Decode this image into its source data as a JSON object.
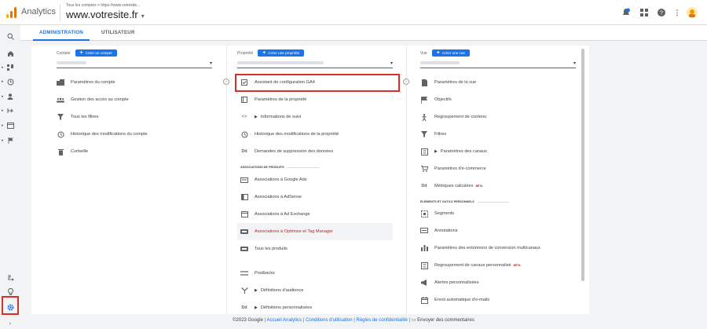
{
  "topbar": {
    "app_name": "Analytics",
    "breadcrumb": "Tous les comptes > https://www.votresite...",
    "account_name": "www.votresite.fr",
    "colors": {
      "logo": [
        "#f9ab00",
        "#e37400",
        "#e37400"
      ]
    },
    "icons": [
      "notifications-icon",
      "apps-grid-icon",
      "help-icon",
      "more-vert-icon",
      "avatar"
    ]
  },
  "tabs": [
    {
      "label": "ADMINISTRATION"
    },
    {
      "label": "UTILISATEUR"
    }
  ],
  "columns": {
    "account": {
      "label": "Compte",
      "create_label": "Créer un compte",
      "items": [
        {
          "label": "Paramètres du compte",
          "icon": "building-icon"
        },
        {
          "label": "Gestion des accès au compte",
          "icon": "people-icon"
        },
        {
          "label": "Tous les filtres",
          "icon": "filter-icon"
        },
        {
          "label": "Historique des modifications du compte",
          "icon": "history-icon"
        },
        {
          "label": "Corbeille",
          "icon": "trash-icon"
        }
      ]
    },
    "property": {
      "label": "Propriété",
      "create_label": "Créer une propriété",
      "items": [
        {
          "label": "Assistant de configuration GA4",
          "icon": "checkbox-icon"
        },
        {
          "label": "Paramètres de la propriété",
          "icon": "settings-doc-icon"
        },
        {
          "label": "Informations de suivi",
          "icon": "code-icon"
        },
        {
          "label": "Historique des modifications de la propriété",
          "icon": "history-icon"
        },
        {
          "label": "Demandes de suppression des données",
          "icon": "dd-icon"
        }
      ],
      "section_label": "ASSOCIATIONS DE PRODUITS",
      "links": [
        {
          "label": "Associations à Google Ads",
          "icon": "ads-icon"
        },
        {
          "label": "Associations à AdSense",
          "icon": "adsense-icon"
        },
        {
          "label": "Associations à Ad Exchange",
          "icon": "adexchange-icon"
        },
        {
          "label": "Associations à Optimize et Tag Manager",
          "icon": "optimize-icon"
        },
        {
          "label": "Tous les produits",
          "icon": "products-icon"
        }
      ],
      "extra": [
        {
          "label": "Postbacks",
          "icon": "postback-icon"
        },
        {
          "label": "Définitions d'audience",
          "icon": "audience-icon"
        },
        {
          "label": "Définitions personnalisées",
          "icon": "dd-icon"
        }
      ]
    },
    "view": {
      "label": "Vue",
      "create_label": "Créer une vue",
      "items": [
        {
          "label": "Paramètres de la vue",
          "icon": "doc-icon"
        },
        {
          "label": "Objectifs",
          "icon": "flag-icon"
        },
        {
          "label": "Regroupement de contenu",
          "icon": "person-walk-icon"
        },
        {
          "label": "Filtres",
          "icon": "filter-icon"
        },
        {
          "label": "Paramètres des canaux",
          "icon": "channel-icon"
        },
        {
          "label": "Paramètres d'e-commerce",
          "icon": "cart-icon"
        },
        {
          "label": "Métriques calculées",
          "icon": "dd-icon",
          "badge": "BÊTA"
        }
      ],
      "section_label": "ÉLÉMENTS ET OUTILS PERSONNELS",
      "personal": [
        {
          "label": "Segments",
          "icon": "segments-icon"
        },
        {
          "label": "Annotations",
          "icon": "annotation-icon"
        },
        {
          "label": "Paramètres des entonnoirs de conversion multicanaux",
          "icon": "bars-icon"
        },
        {
          "label": "Regroupement de canaux personnalisé",
          "icon": "channel-icon",
          "badge": "BÊTA"
        },
        {
          "label": "Alertes personnalisées",
          "icon": "megaphone-icon"
        },
        {
          "label": "Envoi automatique d'e-mails",
          "icon": "calendar-icon"
        }
      ]
    }
  },
  "footer": {
    "copyright": "©2023 Google",
    "links": [
      "Accueil Analytics",
      "Conditions d'utilisation",
      "Règles de confidentialité"
    ],
    "feedback": "Envoyer des commentaires"
  }
}
